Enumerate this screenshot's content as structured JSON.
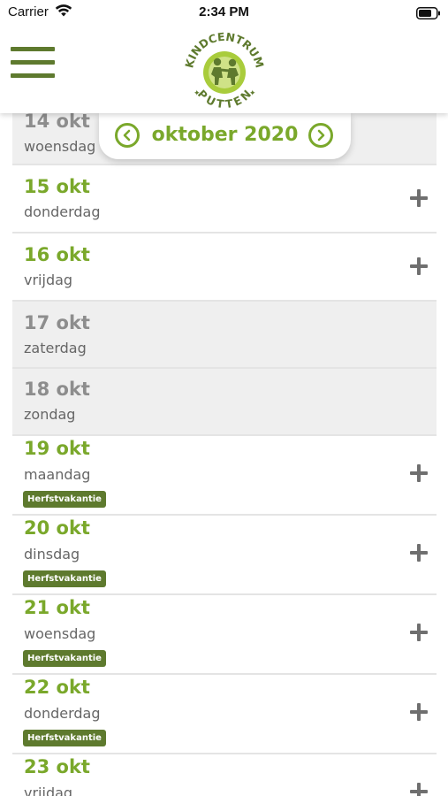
{
  "status_bar": {
    "carrier": "Carrier",
    "time": "2:34 PM"
  },
  "header": {
    "menu_icon": "hamburger-menu-icon",
    "logo": {
      "text_top": "KINDCENTRUM",
      "text_bottom": "PUTTEN"
    }
  },
  "month_selector": {
    "label": "oktober 2020",
    "prev_icon": "chevron-left-circle-icon",
    "next_icon": "chevron-right-circle-icon"
  },
  "colors": {
    "accent_green": "#7aa82b",
    "dark_green": "#5e7a2e",
    "disabled_text": "#8d8d8d",
    "disabled_bg": "#efefef"
  },
  "days": [
    {
      "date": "14 okt",
      "weekday": "woensdag",
      "disabled": true,
      "badge": "",
      "addable": false
    },
    {
      "date": "15 okt",
      "weekday": "donderdag",
      "disabled": false,
      "badge": "",
      "addable": true
    },
    {
      "date": "16 okt",
      "weekday": "vrijdag",
      "disabled": false,
      "badge": "",
      "addable": true
    },
    {
      "date": "17 okt",
      "weekday": "zaterdag",
      "disabled": true,
      "badge": "",
      "addable": false
    },
    {
      "date": "18 okt",
      "weekday": "zondag",
      "disabled": true,
      "badge": "",
      "addable": false
    },
    {
      "date": "19 okt",
      "weekday": "maandag",
      "disabled": false,
      "badge": "Herfstvakantie",
      "addable": true
    },
    {
      "date": "20 okt",
      "weekday": "dinsdag",
      "disabled": false,
      "badge": "Herfstvakantie",
      "addable": true
    },
    {
      "date": "21 okt",
      "weekday": "woensdag",
      "disabled": false,
      "badge": "Herfstvakantie",
      "addable": true
    },
    {
      "date": "22 okt",
      "weekday": "donderdag",
      "disabled": false,
      "badge": "Herfstvakantie",
      "addable": true
    },
    {
      "date": "23 okt",
      "weekday": "vrijdag",
      "disabled": false,
      "badge": "",
      "addable": true
    }
  ]
}
